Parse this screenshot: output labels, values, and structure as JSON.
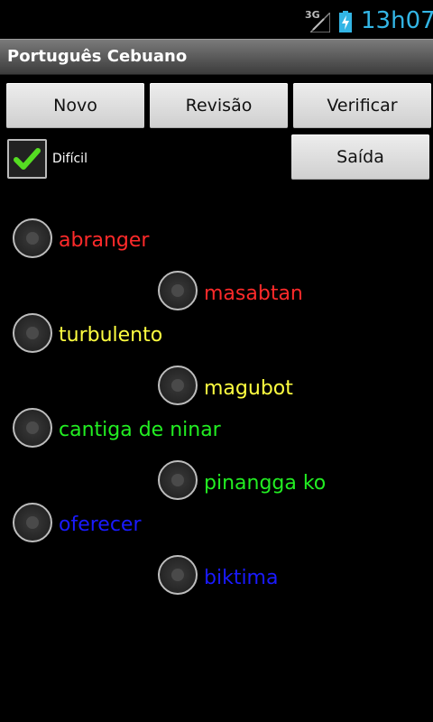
{
  "status_bar": {
    "network": "3G",
    "time": "13h07"
  },
  "title": "Português Cebuano",
  "buttons": {
    "novo": "Novo",
    "revisao": "Revisão",
    "verificar": "Verificar",
    "saida": "Saída"
  },
  "difficult": {
    "label": "Difícil",
    "checked": true
  },
  "items": [
    {
      "label": "abranger",
      "color": "#ff2a2a"
    },
    {
      "label": "masabtan",
      "color": "#ff2a2a"
    },
    {
      "label": "turbulento",
      "color": "#ffff40"
    },
    {
      "label": "magubot",
      "color": "#ffff40"
    },
    {
      "label": "cantiga de ninar",
      "color": "#22ee22"
    },
    {
      "label": "pinangga ko",
      "color": "#22ee22"
    },
    {
      "label": "oferecer",
      "color": "#1a1aff"
    },
    {
      "label": "biktima",
      "color": "#1a1aff"
    }
  ],
  "colors": {
    "accent": "#33b5e5",
    "check": "#55dd22"
  }
}
